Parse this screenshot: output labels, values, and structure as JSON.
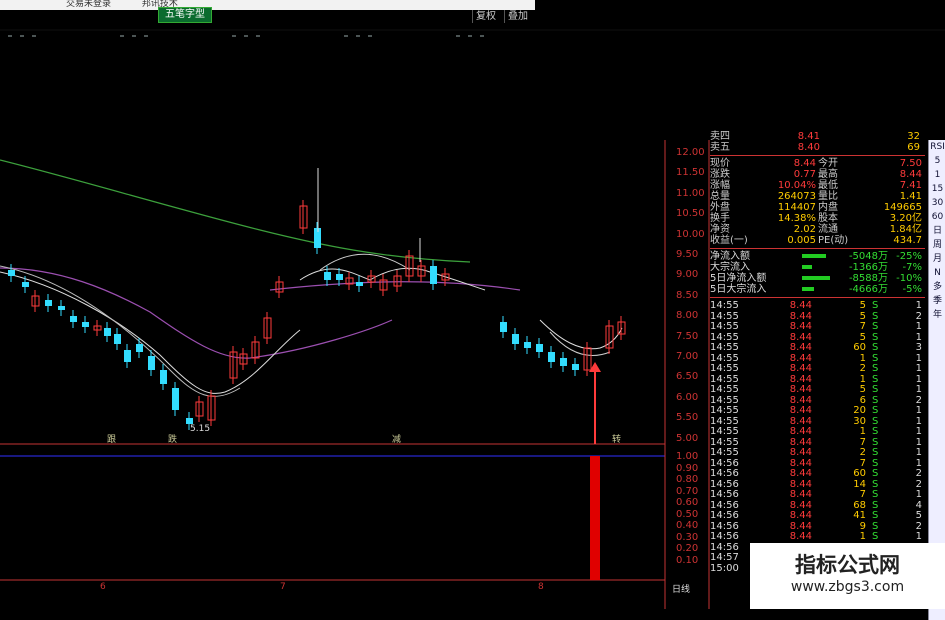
{
  "topbar": {
    "item1": "交易未登录",
    "item2": "邦讯技术"
  },
  "formula_tab": {
    "label": "五笔字型"
  },
  "toolbar": {
    "restore_label": "复权",
    "overlay_label": "叠加"
  },
  "price_axis": [
    "12.00",
    "11.50",
    "11.00",
    "10.50",
    "10.00",
    "9.50",
    "9.00",
    "8.50",
    "8.00",
    "7.50",
    "7.00",
    "6.50",
    "6.00",
    "5.50",
    "5.00"
  ],
  "indicator_axis": [
    "1.00",
    "0.90",
    "0.80",
    "0.70",
    "0.60",
    "0.50",
    "0.40",
    "0.30",
    "0.20",
    "0.10"
  ],
  "low_label": "5.15",
  "signals": [
    "跟",
    "跌",
    "减",
    "转"
  ],
  "x_labels": [
    "6",
    "7",
    "8"
  ],
  "period_label": "日线",
  "quote": {
    "sell4": {
      "label": "卖四",
      "value": "8.41",
      "vol": "32"
    },
    "sell5": {
      "label": "卖五",
      "value": "8.40",
      "vol": "69"
    },
    "rows": [
      {
        "l1": "现价",
        "v1": "8.44",
        "l2": "今开",
        "v2": "7.50"
      },
      {
        "l1": "涨跌",
        "v1": "0.77",
        "l2": "最高",
        "v2": "8.44"
      },
      {
        "l1": "涨幅",
        "v1": "10.04%",
        "l2": "最低",
        "v2": "7.41"
      },
      {
        "l1": "总量",
        "v1": "264073",
        "l2": "量比",
        "v2": "1.41"
      },
      {
        "l1": "外盘",
        "v1": "114407",
        "l2": "内盘",
        "v2": "149665"
      },
      {
        "l1": "换手",
        "v1": "14.38%",
        "l2": "股本",
        "v2": "3.20亿"
      },
      {
        "l1": "净资",
        "v1": "2.02",
        "l2": "流通",
        "v2": "1.84亿"
      },
      {
        "l1": "收益(一)",
        "v1": "0.005",
        "l2": "PE(动)",
        "v2": "434.7"
      }
    ],
    "flows": [
      {
        "label": "净流入额",
        "value": "-5048万",
        "pct": "-25%"
      },
      {
        "label": "大宗流入",
        "value": "-1366万",
        "pct": "-7%"
      },
      {
        "label": "5日净流入额",
        "value": "-8588万",
        "pct": "-10%"
      },
      {
        "label": "5日大宗流入",
        "value": "-4666万",
        "pct": "-5%"
      }
    ]
  },
  "ticks": [
    {
      "t": "14:55",
      "p": "8.44",
      "v": "5",
      "s": "S",
      "n": "1"
    },
    {
      "t": "14:55",
      "p": "8.44",
      "v": "5",
      "s": "S",
      "n": "2"
    },
    {
      "t": "14:55",
      "p": "8.44",
      "v": "7",
      "s": "S",
      "n": "1"
    },
    {
      "t": "14:55",
      "p": "8.44",
      "v": "5",
      "s": "S",
      "n": "1"
    },
    {
      "t": "14:55",
      "p": "8.44",
      "v": "60",
      "s": "S",
      "n": "3"
    },
    {
      "t": "14:55",
      "p": "8.44",
      "v": "1",
      "s": "S",
      "n": "1"
    },
    {
      "t": "14:55",
      "p": "8.44",
      "v": "2",
      "s": "S",
      "n": "1"
    },
    {
      "t": "14:55",
      "p": "8.44",
      "v": "1",
      "s": "S",
      "n": "1"
    },
    {
      "t": "14:55",
      "p": "8.44",
      "v": "5",
      "s": "S",
      "n": "1"
    },
    {
      "t": "14:55",
      "p": "8.44",
      "v": "6",
      "s": "S",
      "n": "2"
    },
    {
      "t": "14:55",
      "p": "8.44",
      "v": "20",
      "s": "S",
      "n": "1"
    },
    {
      "t": "14:55",
      "p": "8.44",
      "v": "30",
      "s": "S",
      "n": "1"
    },
    {
      "t": "14:55",
      "p": "8.44",
      "v": "1",
      "s": "S",
      "n": "1"
    },
    {
      "t": "14:55",
      "p": "8.44",
      "v": "7",
      "s": "S",
      "n": "1"
    },
    {
      "t": "14:55",
      "p": "8.44",
      "v": "2",
      "s": "S",
      "n": "1"
    },
    {
      "t": "14:56",
      "p": "8.44",
      "v": "7",
      "s": "S",
      "n": "1"
    },
    {
      "t": "14:56",
      "p": "8.44",
      "v": "60",
      "s": "S",
      "n": "2"
    },
    {
      "t": "14:56",
      "p": "8.44",
      "v": "14",
      "s": "S",
      "n": "2"
    },
    {
      "t": "14:56",
      "p": "8.44",
      "v": "7",
      "s": "S",
      "n": "1"
    },
    {
      "t": "14:56",
      "p": "8.44",
      "v": "68",
      "s": "S",
      "n": "4"
    },
    {
      "t": "14:56",
      "p": "8.44",
      "v": "41",
      "s": "S",
      "n": "5"
    },
    {
      "t": "14:56",
      "p": "8.44",
      "v": "9",
      "s": "S",
      "n": "2"
    },
    {
      "t": "14:56",
      "p": "8.44",
      "v": "1",
      "s": "S",
      "n": "1"
    },
    {
      "t": "14:56",
      "p": "8.44",
      "v": "1",
      "s": "S",
      "n": "1"
    },
    {
      "t": "14:57",
      "p": "8.44",
      "v": "",
      "s": "",
      "n": ""
    },
    {
      "t": "15:00",
      "p": "8.44",
      "v": "",
      "s": "",
      "n": ""
    }
  ],
  "sidebar": [
    "RSI",
    "5",
    "1",
    "15",
    "30",
    "60",
    "日",
    "周",
    "月",
    "N",
    "多",
    "季",
    "年"
  ],
  "watermark": {
    "line1": "指标公式网",
    "line2": "www.zbgs3.com"
  },
  "colors": {
    "up": "#ff3b3b",
    "down": "#33ddff",
    "axis": "#c33333",
    "ma_white": "#ffffff",
    "ma_green": "#3ca03c",
    "ma_purple": "#9b4fb0"
  }
}
